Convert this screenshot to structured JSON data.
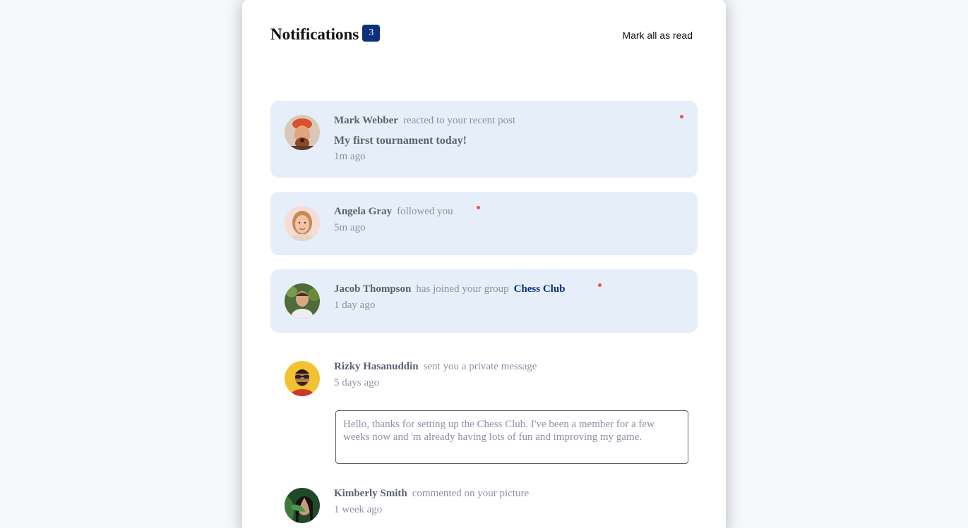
{
  "header": {
    "title": "Notifications",
    "unread_count": "3",
    "mark_all_label": "Mark all as read"
  },
  "notifications": [
    {
      "user": "Mark Webber",
      "action": "reacted to your recent post",
      "post": "My first tournament today!",
      "time": "1m ago",
      "unread": true
    },
    {
      "user": "Angela Gray",
      "action": "followed you",
      "time": "5m ago",
      "unread": true
    },
    {
      "user": "Jacob Thompson",
      "action": "has joined your group",
      "group": "Chess Club",
      "time": "1 day ago",
      "unread": true
    },
    {
      "user": "Rizky Hasanuddin",
      "action": "sent you a private message",
      "time": "5 days ago",
      "message": "Hello, thanks for setting up the Chess Club. I've been a member for a few weeks now and 'm already having lots of fun and improving my game.",
      "unread": false
    },
    {
      "user": "Kimberly Smith",
      "action": "commented on your picture",
      "time": "1 week ago",
      "unread": false
    }
  ],
  "colors": {
    "accent": "#0a317b",
    "unread_bg": "#e5eef9",
    "dot": "#f0514f",
    "page_bg": "#f6f9fc"
  },
  "icons": {
    "avatars": [
      "avatar-mark-webber",
      "avatar-angela-gray",
      "avatar-jacob-thompson",
      "avatar-rizky-hasanuddin",
      "avatar-kimberly-smith"
    ],
    "unread_indicator": "red-dot-icon"
  }
}
